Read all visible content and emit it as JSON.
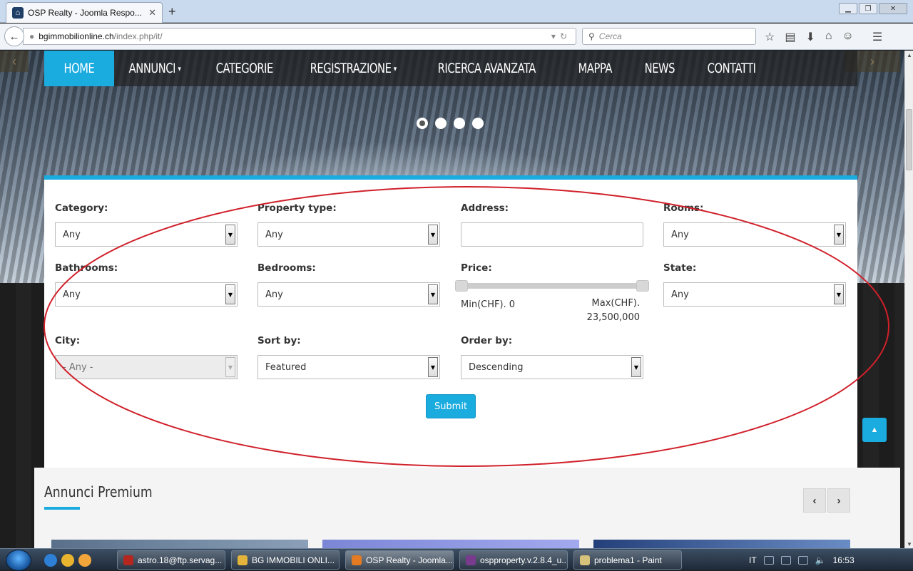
{
  "browser": {
    "tab_title": "OSP Realty - Joomla Respo...",
    "url_host": "bgimmobilionline.ch",
    "url_path": "/index.php/it/",
    "search_placeholder": "Cerca"
  },
  "site": {
    "menu": [
      {
        "label": "HOME"
      },
      {
        "label": "ANNUNCI"
      },
      {
        "label": "CATEGORIE"
      },
      {
        "label": "REGISTRAZIONE"
      },
      {
        "label": "RICERCA AVANZATA"
      },
      {
        "label": "MAPPA"
      },
      {
        "label": "NEWS"
      },
      {
        "label": "CONTATTI"
      }
    ],
    "slider_dots": 4,
    "slider_active_dot": 1
  },
  "search_form": {
    "category_label": "Category:",
    "category_value": "Any",
    "property_type_label": "Property type:",
    "property_type_value": "Any",
    "address_label": "Address:",
    "address_value": "",
    "rooms_label": "Rooms:",
    "rooms_value": "Any",
    "bathrooms_label": "Bathrooms:",
    "bathrooms_value": "Any",
    "bedrooms_label": "Bedrooms:",
    "bedrooms_value": "Any",
    "price_label": "Price:",
    "price_min": "Min(CHF). 0",
    "price_max": "Max(CHF). 23,500,000",
    "state_label": "State:",
    "state_value": "Any",
    "city_label": "City:",
    "city_value": "- Any -",
    "sort_by_label": "Sort by:",
    "sort_by_value": "Featured",
    "order_by_label": "Order by:",
    "order_by_value": "Descending",
    "submit_label": "Submit"
  },
  "premium": {
    "title": "Annunci Premium"
  },
  "taskbar": {
    "items": [
      {
        "label": "astro.18@ftp.servag..."
      },
      {
        "label": "BG IMMOBILI ONLI..."
      },
      {
        "label": "OSP Realty - Joomla..."
      },
      {
        "label": "ospproperty.v.2.8.4_u..."
      },
      {
        "label": "problema1 - Paint"
      }
    ],
    "language": "IT",
    "clock": "16:53"
  },
  "colors": {
    "accent": "#1aabdf",
    "annotation": "#d0202a"
  }
}
